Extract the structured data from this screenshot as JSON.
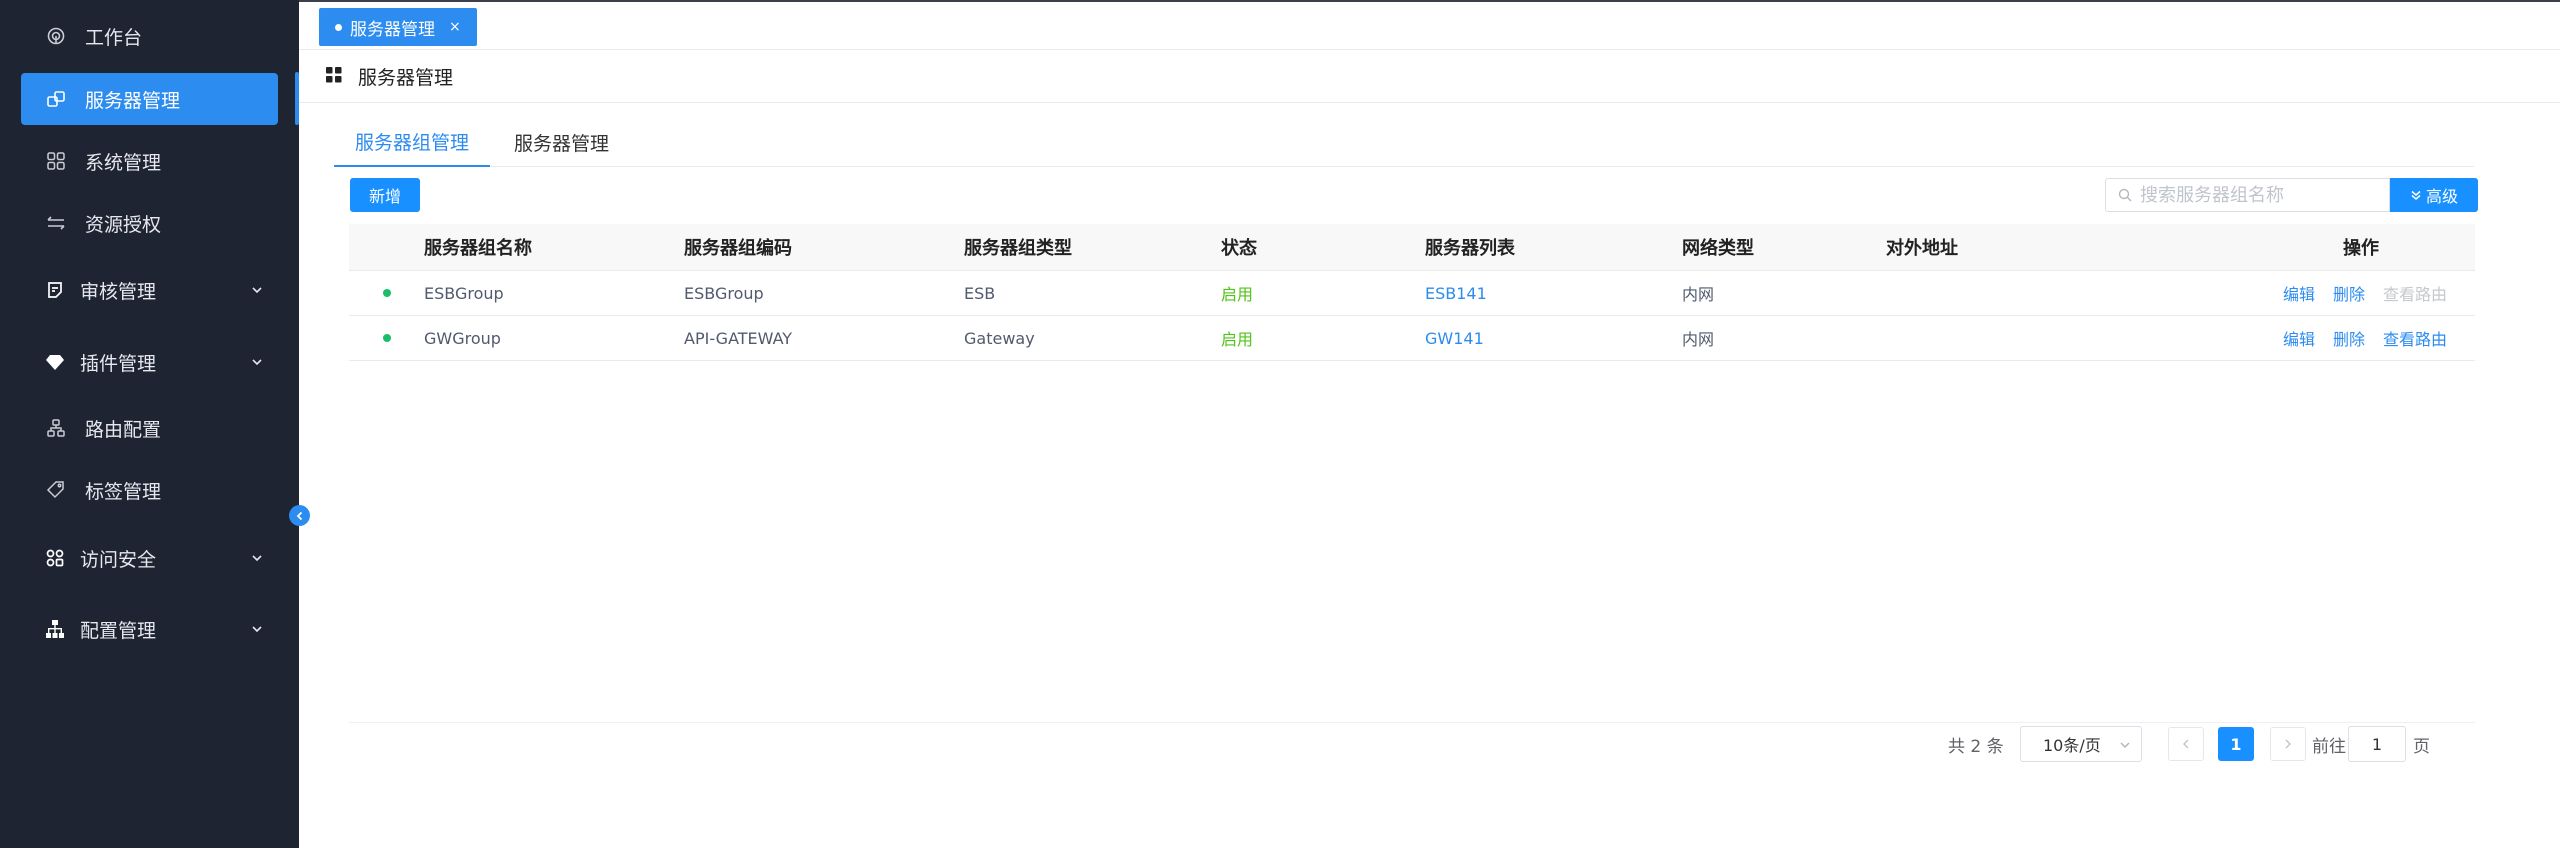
{
  "sidebar": {
    "items": [
      {
        "label": "工作台",
        "icon": "dashboard-icon",
        "active": false,
        "expandable": false
      },
      {
        "label": "服务器管理",
        "icon": "server-icon",
        "active": true,
        "expandable": false
      },
      {
        "label": "系统管理",
        "icon": "apps-icon",
        "active": false,
        "expandable": false
      },
      {
        "label": "资源授权",
        "icon": "transfer-icon",
        "active": false,
        "expandable": false
      },
      {
        "label": "审核管理",
        "icon": "audit-icon",
        "active": false,
        "expandable": true
      },
      {
        "label": "插件管理",
        "icon": "diamond-icon",
        "active": false,
        "expandable": true
      },
      {
        "label": "路由配置",
        "icon": "route-icon",
        "active": false,
        "expandable": false
      },
      {
        "label": "标签管理",
        "icon": "tag-icon",
        "active": false,
        "expandable": false
      },
      {
        "label": "访问安全",
        "icon": "security-icon",
        "active": false,
        "expandable": true
      },
      {
        "label": "配置管理",
        "icon": "org-icon",
        "active": false,
        "expandable": true
      }
    ]
  },
  "open_tab": {
    "label": "服务器管理",
    "close": "×"
  },
  "page_title": "服务器管理",
  "tabs": [
    {
      "label": "服务器组管理",
      "active": true
    },
    {
      "label": "服务器管理",
      "active": false
    }
  ],
  "toolbar": {
    "add_label": "新增",
    "search_placeholder": "搜索服务器组名称",
    "advanced_label": "高级"
  },
  "table": {
    "columns": [
      "服务器组名称",
      "服务器组编码",
      "服务器组类型",
      "状态",
      "服务器列表",
      "网络类型",
      "对外地址",
      "操作"
    ],
    "rows": [
      {
        "name": "ESBGroup",
        "code": "ESBGroup",
        "type": "ESB",
        "status": "启用",
        "servers": "ESB141",
        "network": "内网",
        "address": "",
        "actions": [
          "编辑",
          "删除",
          "查看路由"
        ],
        "route_enabled": false
      },
      {
        "name": "GWGroup",
        "code": "API-GATEWAY",
        "type": "Gateway",
        "status": "启用",
        "servers": "GW141",
        "network": "内网",
        "address": "",
        "actions": [
          "编辑",
          "删除",
          "查看路由"
        ],
        "route_enabled": true
      }
    ]
  },
  "pagination": {
    "total_text": "共 2 条",
    "page_size": "10条/页",
    "current_page": "1",
    "goto_prefix": "前往",
    "goto_value": "1",
    "goto_suffix": "页"
  },
  "colors": {
    "sidebar_bg": "#1f2433",
    "accent": "#1890ff",
    "status_green": "#52c41a"
  }
}
